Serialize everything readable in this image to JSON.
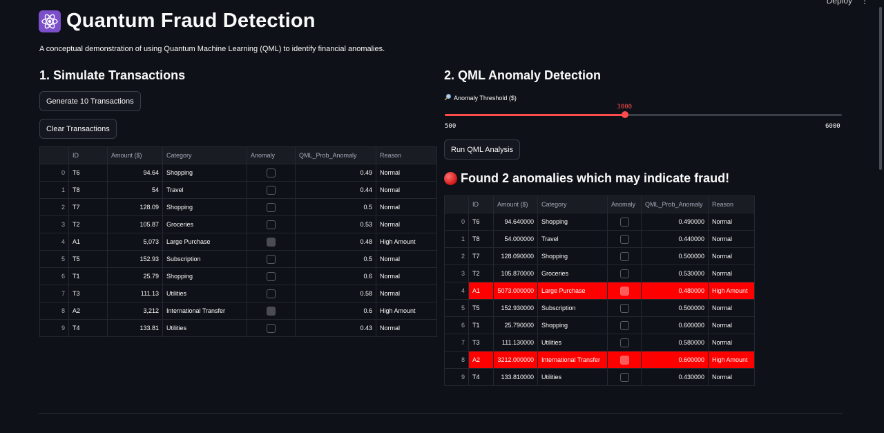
{
  "header": {
    "deploy_label": "Deploy",
    "menu_glyph": "⋮"
  },
  "app": {
    "title": "Quantum Fraud Detection",
    "subtitle": "A conceptual demonstration of using Quantum Machine Learning (QML) to identify financial anomalies."
  },
  "simulate": {
    "heading": "1. Simulate Transactions",
    "generate_label": "Generate 10 Transactions",
    "clear_label": "Clear Transactions",
    "columns": [
      "",
      "ID",
      "Amount ($)",
      "Category",
      "Anomaly",
      "QML_Prob_Anomaly",
      "Reason"
    ],
    "rows": [
      {
        "idx": "0",
        "id": "T6",
        "amount": "94.64",
        "category": "Shopping",
        "anomaly": false,
        "prob": "0.49",
        "reason": "Normal"
      },
      {
        "idx": "1",
        "id": "T8",
        "amount": "54",
        "category": "Travel",
        "anomaly": false,
        "prob": "0.44",
        "reason": "Normal"
      },
      {
        "idx": "2",
        "id": "T7",
        "amount": "128.09",
        "category": "Shopping",
        "anomaly": false,
        "prob": "0.5",
        "reason": "Normal"
      },
      {
        "idx": "3",
        "id": "T2",
        "amount": "105.87",
        "category": "Groceries",
        "anomaly": false,
        "prob": "0.53",
        "reason": "Normal"
      },
      {
        "idx": "4",
        "id": "A1",
        "amount": "5,073",
        "category": "Large Purchase",
        "anomaly": true,
        "prob": "0.48",
        "reason": "High Amount"
      },
      {
        "idx": "5",
        "id": "T5",
        "amount": "152.93",
        "category": "Subscription",
        "anomaly": false,
        "prob": "0.5",
        "reason": "Normal"
      },
      {
        "idx": "6",
        "id": "T1",
        "amount": "25.79",
        "category": "Shopping",
        "anomaly": false,
        "prob": "0.6",
        "reason": "Normal"
      },
      {
        "idx": "7",
        "id": "T3",
        "amount": "111.13",
        "category": "Utilities",
        "anomaly": false,
        "prob": "0.58",
        "reason": "Normal"
      },
      {
        "idx": "8",
        "id": "A2",
        "amount": "3,212",
        "category": "International Transfer",
        "anomaly": true,
        "prob": "0.6",
        "reason": "High Amount"
      },
      {
        "idx": "9",
        "id": "T4",
        "amount": "133.81",
        "category": "Utilities",
        "anomaly": false,
        "prob": "0.43",
        "reason": "Normal"
      }
    ]
  },
  "detect": {
    "heading": "2. QML Anomaly Detection",
    "threshold_icon": "magnifier-icon",
    "threshold_label": "Anomaly Threshold ($)",
    "threshold_value": "3000",
    "threshold_min": "500",
    "threshold_max": "6000",
    "run_label": "Run QML Analysis",
    "alert_text": "Found 2 anomalies which may indicate fraud!",
    "highlight_color": "#ff0000",
    "columns": [
      "",
      "ID",
      "Amount ($)",
      "Category",
      "Anomaly",
      "QML_Prob_Anomaly",
      "Reason"
    ],
    "rows": [
      {
        "idx": "0",
        "id": "T6",
        "amount": "94.640000",
        "category": "Shopping",
        "anomaly": false,
        "prob": "0.490000",
        "reason": "Normal",
        "flagged": false
      },
      {
        "idx": "1",
        "id": "T8",
        "amount": "54.000000",
        "category": "Travel",
        "anomaly": false,
        "prob": "0.440000",
        "reason": "Normal",
        "flagged": false
      },
      {
        "idx": "2",
        "id": "T7",
        "amount": "128.090000",
        "category": "Shopping",
        "anomaly": false,
        "prob": "0.500000",
        "reason": "Normal",
        "flagged": false
      },
      {
        "idx": "3",
        "id": "T2",
        "amount": "105.870000",
        "category": "Groceries",
        "anomaly": false,
        "prob": "0.530000",
        "reason": "Normal",
        "flagged": false
      },
      {
        "idx": "4",
        "id": "A1",
        "amount": "5073.000000",
        "category": "Large Purchase",
        "anomaly": true,
        "prob": "0.480000",
        "reason": "High Amount",
        "flagged": true
      },
      {
        "idx": "5",
        "id": "T5",
        "amount": "152.930000",
        "category": "Subscription",
        "anomaly": false,
        "prob": "0.500000",
        "reason": "Normal",
        "flagged": false
      },
      {
        "idx": "6",
        "id": "T1",
        "amount": "25.790000",
        "category": "Shopping",
        "anomaly": false,
        "prob": "0.600000",
        "reason": "Normal",
        "flagged": false
      },
      {
        "idx": "7",
        "id": "T3",
        "amount": "111.130000",
        "category": "Utilities",
        "anomaly": false,
        "prob": "0.580000",
        "reason": "Normal",
        "flagged": false
      },
      {
        "idx": "8",
        "id": "A2",
        "amount": "3212.000000",
        "category": "International Transfer",
        "anomaly": true,
        "prob": "0.600000",
        "reason": "High Amount",
        "flagged": true
      },
      {
        "idx": "9",
        "id": "T4",
        "amount": "133.810000",
        "category": "Utilities",
        "anomaly": false,
        "prob": "0.430000",
        "reason": "Normal",
        "flagged": false
      }
    ]
  }
}
